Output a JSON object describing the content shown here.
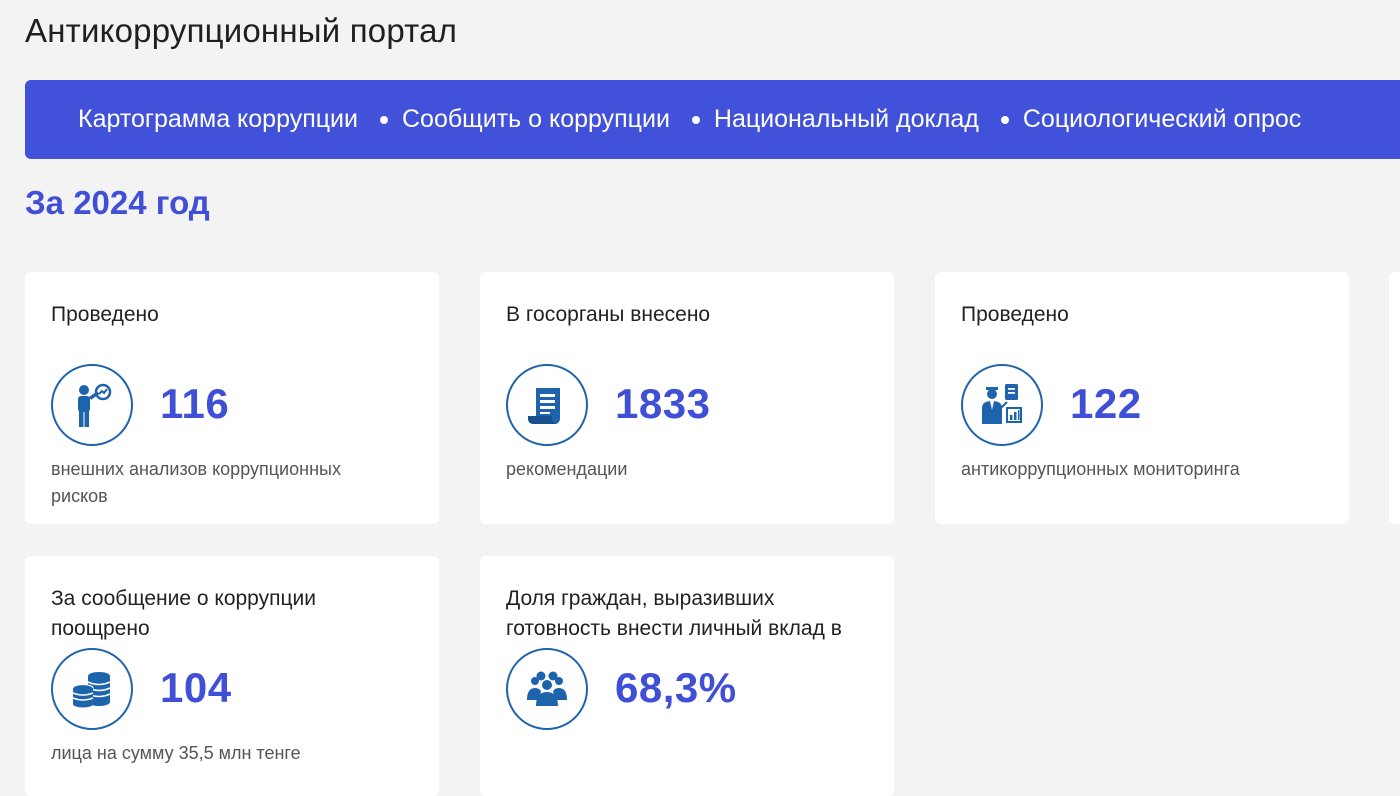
{
  "header": {
    "title": "Антикоррупционный портал"
  },
  "nav": {
    "items": [
      {
        "label": "Картограмма коррупции"
      },
      {
        "label": "Сообщить о коррупции"
      },
      {
        "label": "Национальный доклад"
      },
      {
        "label": "Социологический опрос"
      }
    ]
  },
  "section": {
    "title": "За 2024 год"
  },
  "cards": [
    {
      "label": "Проведено",
      "icon": "analyst-icon",
      "value": "116",
      "desc": "внешних анализов коррупционных рисков"
    },
    {
      "label": "В госорганы внесено",
      "icon": "document-scroll-icon",
      "value": "1833",
      "desc": "рекомендации"
    },
    {
      "label": "Проведено",
      "icon": "monitoring-presenter-icon",
      "value": "122",
      "desc": "антикоррупционных мониторинга"
    },
    {
      "label": "За сообщение о коррупции поощрено",
      "icon": "coins-stack-icon",
      "value": "104",
      "desc": "лица на сумму 35,5 млн тенге"
    },
    {
      "label": "Доля граждан, выразивших готовность внести личный вклад в",
      "icon": "people-group-icon",
      "value": "68,3%",
      "desc": ""
    }
  ],
  "colors": {
    "accent": "#3f4fd6",
    "nav_bg": "#4151d9",
    "icon_blue": "#1e64ad"
  }
}
